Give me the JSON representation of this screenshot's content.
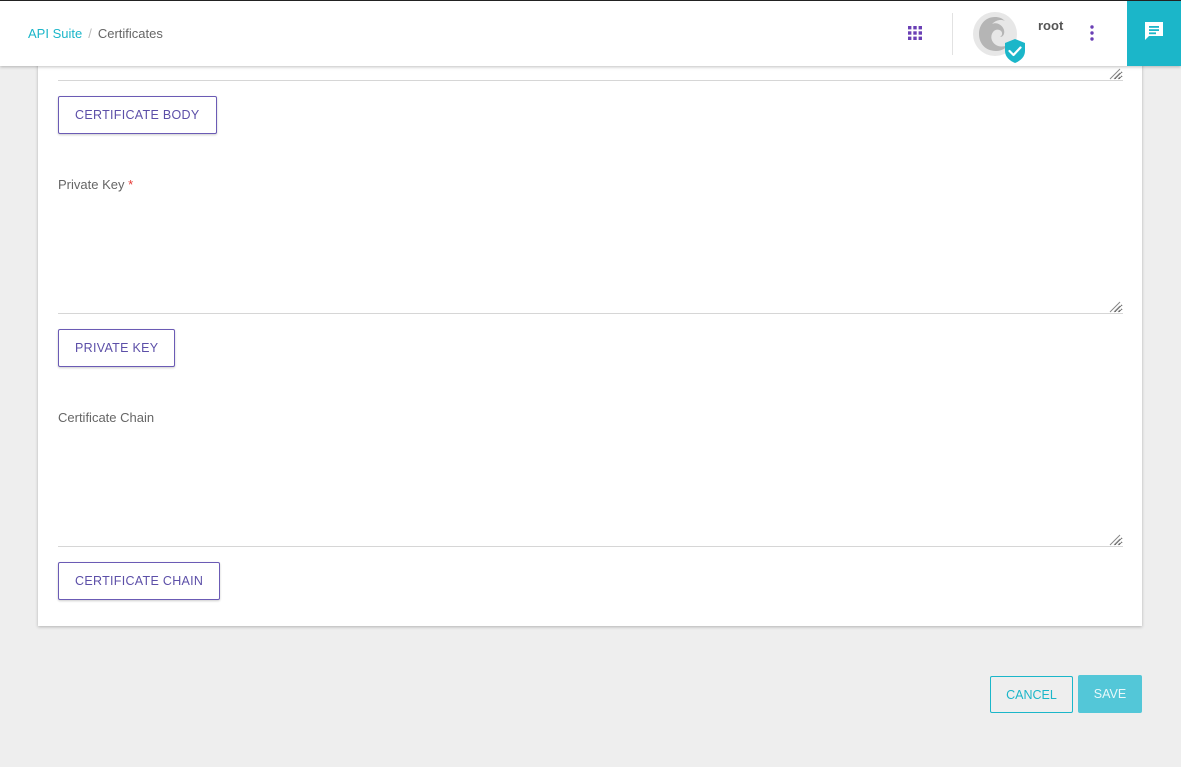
{
  "header": {
    "breadcrumb": {
      "root": "API Suite",
      "separator": "/",
      "current": "Certificates"
    },
    "apps_icon": "grid-apps-icon",
    "username": "root",
    "menu_icon": "more-vert-icon",
    "chat_icon": "chat-icon"
  },
  "form": {
    "certificate_body_button": "CERTIFICATE BODY",
    "private_key_label": "Private Key",
    "private_key_required": "*",
    "private_key_button": "PRIVATE KEY",
    "certificate_chain_label": "Certificate Chain",
    "certificate_chain_button": "CERTIFICATE CHAIN"
  },
  "actions": {
    "cancel_label": "CANCEL",
    "save_label": "SAVE"
  },
  "colors": {
    "accent": "#1bb6c9",
    "button_outline": "#6b5bb5",
    "required": "#e53935"
  }
}
